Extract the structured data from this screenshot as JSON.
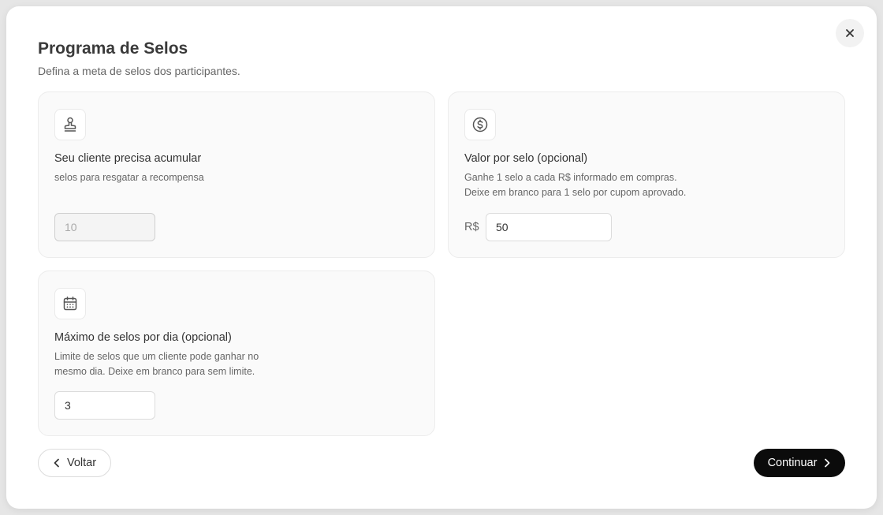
{
  "modal": {
    "title": "Programa de Selos",
    "subtitle": "Defina a meta de selos dos participantes."
  },
  "cards": {
    "goal": {
      "icon": "stamp-icon",
      "title": "Seu cliente precisa acumular",
      "desc": "selos para resgatar a recompensa",
      "input_value": "",
      "input_placeholder": "10"
    },
    "value": {
      "icon": "dollar-circle-icon",
      "title": "Valor por selo (opcional)",
      "desc_line1": "Ganhe 1 selo a cada R$ informado em compras.",
      "desc_line2": "Deixe em branco para 1 selo por cupom aprovado.",
      "currency": "R$",
      "input_value": "50"
    },
    "daily": {
      "icon": "calendar-icon",
      "title": "Máximo de selos por dia (opcional)",
      "desc": "Limite de selos que um cliente pode ganhar no mesmo dia. Deixe em branco para sem limite.",
      "input_value": "3"
    }
  },
  "footer": {
    "back_label": "Voltar",
    "next_label": "Continuar"
  },
  "colors": {
    "primary_button": "#0b0b0b",
    "card_bg": "#fafafa"
  }
}
